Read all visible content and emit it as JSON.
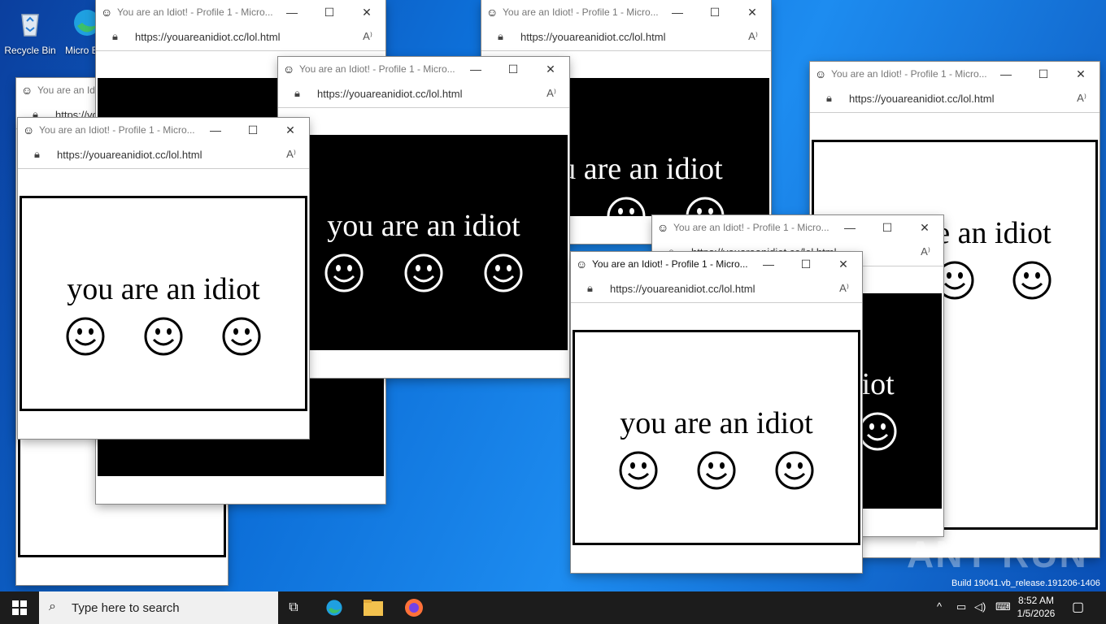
{
  "desktop": {
    "icons": [
      {
        "label": "Recycle Bin",
        "icon": "recycle-bin-icon"
      },
      {
        "label": "Micro Edg",
        "icon": "edge-icon"
      }
    ],
    "watermark": "ANY RUN",
    "build_text": "Build 19041.vb_release.191206-1406"
  },
  "browser": {
    "title": "You are an Idiot! - Profile 1 - Micro...",
    "url": "https://youareanidiot.cc/lol.html",
    "favicon": "smiley-icon",
    "minimize": "—",
    "maximize": "☐",
    "close": "✕",
    "page_text": "you are an idiot",
    "smiley_count": 3
  },
  "windows": [
    {
      "variant": "white"
    },
    {
      "variant": "black"
    },
    {
      "variant": "black"
    },
    {
      "variant": "white"
    },
    {
      "variant": "black"
    },
    {
      "variant": "white"
    },
    {
      "variant": "black"
    },
    {
      "variant": "white",
      "active": true
    }
  ],
  "taskbar": {
    "search_placeholder": "Type here to search",
    "pinned": [
      "task-view-icon",
      "edge-icon",
      "file-explorer-icon",
      "firefox-icon"
    ],
    "time": "8:52 AM",
    "date": "1/5/2026",
    "colors": {
      "taskbar": "#1c1c1c",
      "search": "#f0f0f0"
    }
  }
}
